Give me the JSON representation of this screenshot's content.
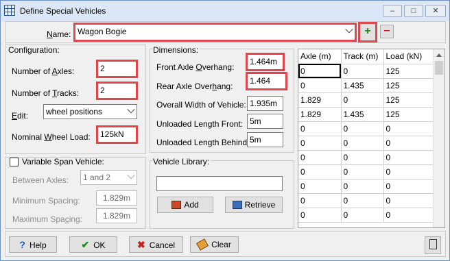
{
  "window": {
    "title": "Define Special Vehicles",
    "min": "–",
    "max": "□",
    "close": "✕"
  },
  "name": {
    "label_pre": "",
    "label_u": "N",
    "label_post": "ame:",
    "value": "Wagon Bogie",
    "add_glyph": "+",
    "remove_glyph": "–"
  },
  "configuration": {
    "title": "Configuration:",
    "axles_label_pre": "Number of ",
    "axles_label_u": "A",
    "axles_label_post": "xles:",
    "axles_value": "2",
    "tracks_label_pre": "Number of ",
    "tracks_label_u": "T",
    "tracks_label_post": "racks:",
    "tracks_value": "2",
    "edit_label_pre": "",
    "edit_label_u": "E",
    "edit_label_post": "dit:",
    "edit_value": "wheel positions",
    "load_label_pre": "Nominal ",
    "load_label_u": "W",
    "load_label_post": "heel Load:",
    "load_value": "125kN"
  },
  "variable_span": {
    "title": "Variable Span Vehicle:",
    "between_label": "Between Axles:",
    "between_value": "1 and 2",
    "min_label": "Minimum Spacing:",
    "min_value": "1.829m",
    "max_label_pre": "Maximum Spa",
    "max_label_u": "c",
    "max_label_post": "ing:",
    "max_value": "1.829m"
  },
  "dimensions": {
    "title": "Dimensions:",
    "front_label_pre": "Front Axle ",
    "front_label_u": "O",
    "front_label_post": "verhang:",
    "front_value": "1.464m",
    "rear_label_pre": "Rear Axle Over",
    "rear_label_u": "h",
    "rear_label_post": "ang:",
    "rear_value": "1.464",
    "width_label": "Overall Width of Vehicle:",
    "width_value": "1.935m",
    "len_front_label": "Unloaded Length Front:",
    "len_front_value": "5m",
    "len_behind_label": "Unloaded Length Behind:",
    "len_behind_value": "5m"
  },
  "library": {
    "title": "Vehicle Library:",
    "input_value": "",
    "add_label": "Add",
    "retrieve_label": "Retrieve"
  },
  "grid": {
    "headers": [
      "Axle (m)",
      "Track (m)",
      "Load (kN)"
    ],
    "rows": [
      [
        "0",
        "0",
        "125"
      ],
      [
        "0",
        "1.435",
        "125"
      ],
      [
        "1.829",
        "0",
        "125"
      ],
      [
        "1.829",
        "1.435",
        "125"
      ],
      [
        "0",
        "0",
        "0"
      ],
      [
        "0",
        "0",
        "0"
      ],
      [
        "0",
        "0",
        "0"
      ],
      [
        "0",
        "0",
        "0"
      ],
      [
        "0",
        "0",
        "0"
      ],
      [
        "0",
        "0",
        "0"
      ],
      [
        "0",
        "0",
        "0"
      ]
    ]
  },
  "buttons": {
    "help": "Help",
    "ok": "OK",
    "cancel": "Cancel",
    "clear": "Clear"
  }
}
